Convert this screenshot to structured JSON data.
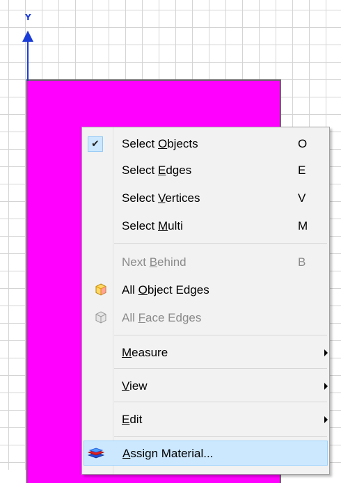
{
  "canvas": {
    "axis_label": "Y",
    "colors": {
      "model_fill": "#ff00ff",
      "axis": "#1a3cd6",
      "grid": "#d4d4d4"
    }
  },
  "context_menu": {
    "items": [
      {
        "id": "select-objects",
        "label": "Select Objects",
        "mnemonic": "O",
        "shortcut": "O",
        "checked": true,
        "enabled": true
      },
      {
        "id": "select-edges",
        "label": "Select Edges",
        "mnemonic": "E",
        "shortcut": "E",
        "enabled": true
      },
      {
        "id": "select-vertices",
        "label": "Select Vertices",
        "mnemonic": "V",
        "shortcut": "V",
        "enabled": true
      },
      {
        "id": "select-multi",
        "label": "Select Multi",
        "mnemonic": "M",
        "shortcut": "M",
        "enabled": true
      },
      {
        "id": "next-behind",
        "label": "Next Behind",
        "mnemonic": "B",
        "shortcut": "B",
        "enabled": false
      },
      {
        "id": "all-object-edges",
        "label": "All Object Edges",
        "mnemonic": "O",
        "icon": "cube-icon",
        "enabled": true
      },
      {
        "id": "all-face-edges",
        "label": "All Face Edges",
        "mnemonic": "F",
        "icon": "cube-icon",
        "enabled": false
      },
      {
        "id": "measure",
        "label": "Measure",
        "mnemonic": "M",
        "submenu": true,
        "enabled": true
      },
      {
        "id": "view",
        "label": "View",
        "mnemonic": "V",
        "submenu": true,
        "enabled": true
      },
      {
        "id": "edit",
        "label": "Edit",
        "mnemonic": "E",
        "submenu": true,
        "enabled": true
      },
      {
        "id": "assign-material",
        "label": "Assign Material...",
        "mnemonic": "A",
        "icon": "material-icon",
        "enabled": true,
        "highlighted": true
      }
    ]
  }
}
